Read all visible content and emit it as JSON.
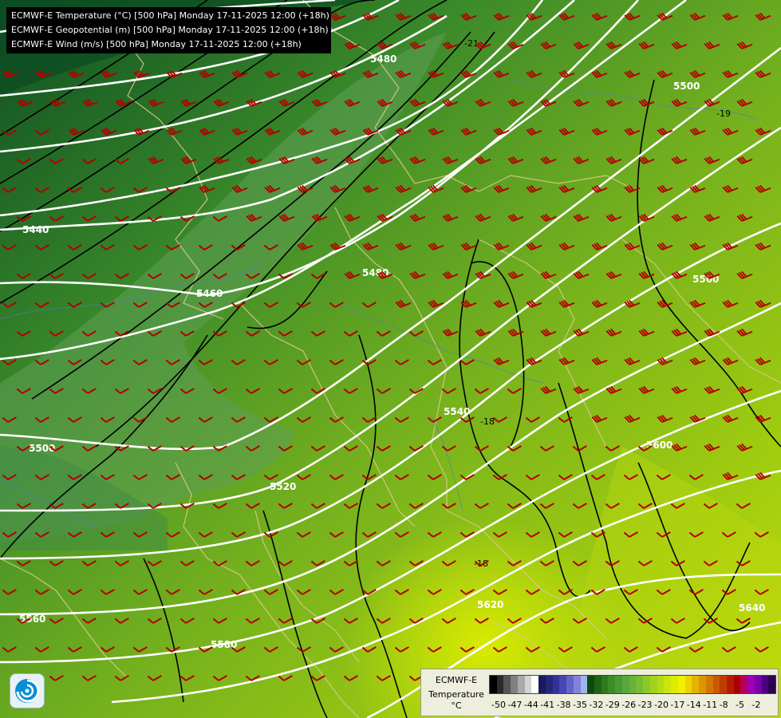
{
  "header": {
    "line1": "ECMWF-E Temperature (°C) [500 hPa] Monday 17-11-2025 12:00 (+18h)",
    "line2": "ECMWF-E Geopotential (m) [500 hPa] Monday 17-11-2025 12:00 (+18h)",
    "line3": "ECMWF-E Wind (m/s) [500 hPa] Monday 17-11-2025 12:00 (+18h)"
  },
  "geopotential_labels": [
    "5440",
    "5460",
    "5480",
    "5500",
    "5520",
    "5540",
    "5560",
    "5580",
    "5600",
    "5620",
    "5640"
  ],
  "temperature_labels": [
    "-21",
    "-19",
    "-18",
    "-18"
  ],
  "legend": {
    "title": "ECMWF-E",
    "subtitle": "Temperature",
    "unit": "°C",
    "ticks": [
      "-50",
      "-47",
      "-44",
      "-41",
      "-38",
      "-35",
      "-32",
      "-29",
      "-26",
      "-23",
      "-20",
      "-17",
      "-14",
      "-11",
      "-8",
      "-5",
      "-2"
    ],
    "colors": [
      "#000000",
      "#2a2a2a",
      "#555555",
      "#808080",
      "#aaaaaa",
      "#d4d4d4",
      "#ffffff",
      "#1a1a5e",
      "#26267a",
      "#323296",
      "#4646b4",
      "#6464c8",
      "#8282dc",
      "#a0b4e8",
      "#0a4a0a",
      "#1e6414",
      "#2e7a1e",
      "#3c8c28",
      "#4a9a32",
      "#5aa83c",
      "#68b23a",
      "#78bc30",
      "#8cc828",
      "#a0d21e",
      "#b4dc14",
      "#c8e60a",
      "#dcee00",
      "#f0f000",
      "#f0d200",
      "#e6b400",
      "#dc9600",
      "#d27800",
      "#c85a00",
      "#be3c00",
      "#b41e00",
      "#aa0000",
      "#b4005a",
      "#9e00b4",
      "#7800aa",
      "#4b0080",
      "#2d0050"
    ]
  }
}
